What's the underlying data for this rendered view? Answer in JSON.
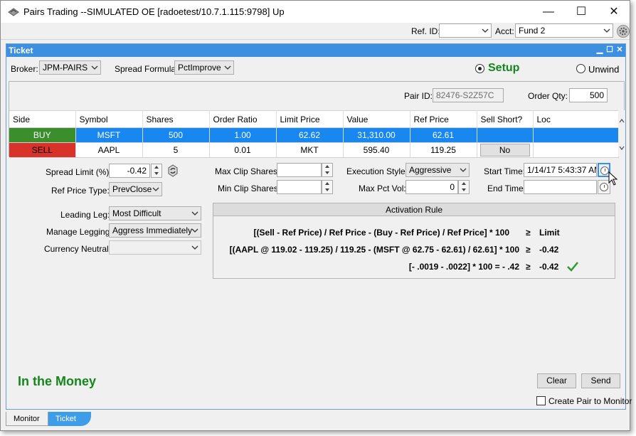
{
  "window": {
    "title": "Pairs Trading  --SIMULATED OE [radoetest/10.7.1.115:9798] Up",
    "minimize_glyph": "—",
    "maximize_glyph": "☐",
    "close_glyph": "✕"
  },
  "toolbar": {
    "ref_id_label": "Ref. ID:",
    "ref_id_value": "",
    "acct_label": "Acct:",
    "acct_value": "Fund 2"
  },
  "panel": {
    "title": "Ticket",
    "broker_label": "Broker:",
    "broker_value": "JPM-PAIRS",
    "spread_formula_label": "Spread Formula:",
    "spread_formula_value": "PctImprove",
    "setup_label": "Setup",
    "unwind_label": "Unwind",
    "mode_selected": "Setup",
    "pair_id_label": "Pair ID:",
    "pair_id_value": "82476-S2Z57C",
    "order_qty_label": "Order Qty:",
    "order_qty_value": "500"
  },
  "grid": {
    "columns": [
      "Side",
      "Symbol",
      "Shares",
      "Order Ratio",
      "Limit Price",
      "Value",
      "Ref Price",
      "Sell Short?",
      "Loc"
    ],
    "rows": [
      {
        "side": "BUY",
        "symbol": "MSFT",
        "shares": "500",
        "order_ratio": "1.00",
        "limit_price": "62.62",
        "value": "31,310.00",
        "ref_price": "62.61",
        "sell_short": "",
        "loc": ""
      },
      {
        "side": "SELL",
        "symbol": "AAPL",
        "shares": "5",
        "order_ratio": "0.01",
        "limit_price": "MKT",
        "value": "595.40",
        "ref_price": "119.25",
        "sell_short": "No",
        "loc": ""
      }
    ]
  },
  "params": {
    "spread_limit_label": "Spread Limit (%):",
    "spread_limit_value": "-0.42",
    "ref_price_type_label": "Ref Price Type:",
    "ref_price_type_value": "PrevClose",
    "max_clip_label": "Max Clip Shares:",
    "max_clip_value": "",
    "min_clip_label": "Min Clip Shares:",
    "min_clip_value": "",
    "exec_style_label": "Execution Style:",
    "exec_style_value": "Aggressive",
    "max_pct_vol_label": "Max Pct Vol:",
    "max_pct_vol_value": "0",
    "start_time_label": "Start Time:",
    "start_time_value": "1/14/17 5:43:37 AM",
    "end_time_label": "End Time:",
    "end_time_value": "",
    "leading_leg_label": "Leading Leg:",
    "leading_leg_value": "Most Difficult",
    "manage_legging_label": "Manage Legging:",
    "manage_legging_value": "Aggress Immediately",
    "currency_neutral_label": "Currency Neutral:",
    "currency_neutral_value": ""
  },
  "activation": {
    "title": "Activation Rule",
    "line1": "[(Sell - Ref Price) / Ref Price - (Buy - Ref Price) / Ref Price] * 100",
    "op1": "≥",
    "rhs1": "Limit",
    "line2": "[(AAPL @ 119.02 - 119.25) / 119.25 - (MSFT @ 62.75 - 62.61) / 62.61] * 100",
    "op2": "≥",
    "rhs2": "-0.42",
    "line3": "[- .0019 - .0022] * 100 = - .42",
    "op3": "≥",
    "rhs3": "-0.42"
  },
  "footer": {
    "status": "In the Money",
    "clear_label": "Clear",
    "send_label": "Send",
    "create_pair_label": "Create Pair to Monitor"
  },
  "tabs": {
    "monitor": "Monitor",
    "ticket": "Ticket"
  },
  "colors": {
    "accent": "#3d8fe0",
    "buy": "#3a8e2b",
    "sell": "#d8322b",
    "selection": "#1987f0",
    "status_green": "#14861d"
  }
}
